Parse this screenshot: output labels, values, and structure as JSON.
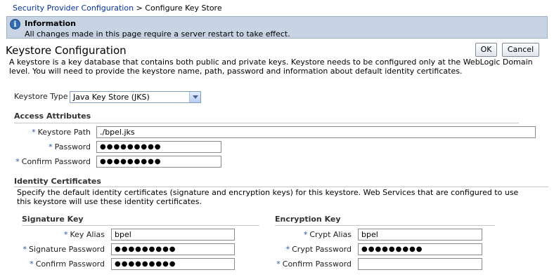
{
  "breadcrumb": {
    "parent": "Security Provider Configuration",
    "separator": " > ",
    "current": "Configure Key Store"
  },
  "info": {
    "icon": "info-icon",
    "title": "Information",
    "message": "All changes made in this page require a server restart to take effect."
  },
  "page": {
    "title": "Keystore Configuration",
    "ok_label": "OK",
    "cancel_label": "Cancel",
    "description": "A keystore is a key database that contains both public and private keys. Keystore needs to be configured only at the WebLogic Domain level. You will need to provide the keystore name, path, password and information about default identity certificates."
  },
  "keystore_type": {
    "label": "Keystore Type",
    "selected": "Java Key Store (JKS)"
  },
  "access": {
    "header": "Access Attributes",
    "required_mark": "*",
    "path_label": "Keystore Path",
    "path_value": "./bpel.jks",
    "password_label": "Password",
    "password_value": "●●●●●●●●●",
    "confirm_label": "Confirm Password",
    "confirm_value": "●●●●●●●●●"
  },
  "identity": {
    "header": "Identity Certificates",
    "description": "Specify the default identity certificates (signature and encryption keys) for this keystore. Web Services that are configured to use this keystore will use these identity certificates."
  },
  "signature": {
    "header": "Signature Key",
    "alias_label": "Key Alias",
    "alias_value": "bpel",
    "password_label": "Signature Password",
    "password_value": "●●●●●●●●●",
    "confirm_label": "Confirm Password",
    "confirm_value": "●●●●●●●●●"
  },
  "encryption": {
    "header": "Encryption Key",
    "alias_label": "Crypt Alias",
    "alias_value": "bpel",
    "password_label": "Crypt Password",
    "password_value": "●●●●●●●●●",
    "confirm_label": "Confirm Password",
    "confirm_value": ""
  }
}
